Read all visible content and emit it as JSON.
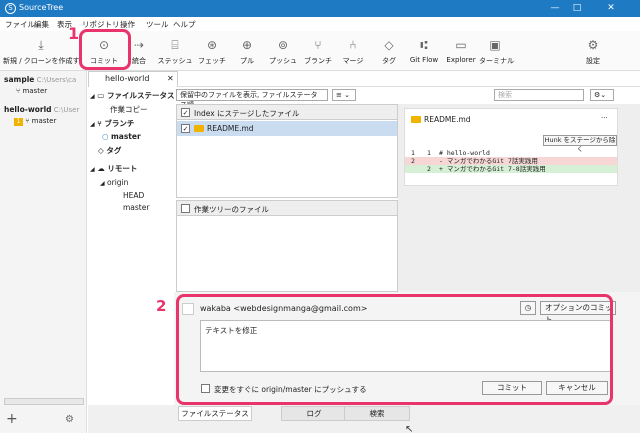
{
  "app": {
    "title": "SourceTree",
    "logo": "S"
  },
  "window_controls": [
    "—",
    "□",
    "✕"
  ],
  "menu": [
    "ファイル",
    "編集",
    "表示",
    "リポジトリ",
    "操作",
    "ツール",
    "ヘルプ"
  ],
  "toolbar": {
    "new_clone": "新規 / クローンを作成す",
    "buttons": [
      {
        "label": "コミット",
        "icon": "commit-icon",
        "glyph": "⊙"
      },
      {
        "label": "統合",
        "icon": "merge-icon",
        "glyph": "⇢"
      },
      {
        "label": "ステッシュ",
        "icon": "stash-icon",
        "glyph": "⌸"
      },
      {
        "label": "フェッチ",
        "icon": "fetch-icon",
        "glyph": "⊛"
      },
      {
        "label": "プル",
        "icon": "pull-icon",
        "glyph": "⊕"
      },
      {
        "label": "プッシュ",
        "icon": "push-icon",
        "glyph": "⊚"
      },
      {
        "label": "ブランチ",
        "icon": "branch-icon",
        "glyph": "⑂"
      },
      {
        "label": "マージ",
        "icon": "merge-branch-icon",
        "glyph": "⑃"
      },
      {
        "label": "タグ",
        "icon": "tag-icon",
        "glyph": "◇"
      },
      {
        "label": "Git Flow",
        "icon": "gitflow-icon",
        "glyph": "⑆"
      },
      {
        "label": "Explorer",
        "icon": "folder-icon",
        "glyph": "▭"
      },
      {
        "label": "ターミナル",
        "icon": "terminal-icon",
        "glyph": "▣"
      }
    ],
    "settings": "設定"
  },
  "sidebar": {
    "repos": [
      {
        "name": "sample",
        "path": "C:\\Users\\ca",
        "branch": "master"
      },
      {
        "name": "hello-world",
        "path": "C:\\User",
        "badge": "1",
        "branch": "master"
      }
    ],
    "add": "+"
  },
  "tab": {
    "label": "hello-world",
    "close": "✕"
  },
  "nav": {
    "file_status": "ファイルステータス",
    "working_copy": "作業コピー",
    "branches": "ブランチ",
    "branch_master": "master",
    "tags": "タグ",
    "remotes": "リモート",
    "origin": "origin",
    "head": "HEAD",
    "remote_master": "master"
  },
  "filter": {
    "select_value": "保留中のファイルを表示, ファイルステータス順",
    "view_menu": "≡",
    "search_placeholder": "検索"
  },
  "staged": {
    "header": "Index にステージしたファイル",
    "files": [
      "README.md"
    ]
  },
  "unstaged": {
    "header": "作業ツリーのファイル"
  },
  "diff": {
    "filename": "README.md",
    "more": "···",
    "hunk_button": "Hunk をステージから除く",
    "lines": [
      {
        "old": "1",
        "new": "1",
        "text": "  # hello-world",
        "kind": "ctx"
      },
      {
        "old": "2",
        "new": "",
        "text": "- マンガでわかるGit 7話実践用",
        "kind": "del"
      },
      {
        "old": "",
        "new": "2",
        "text": "+ マンガでわかるGit 7-8話実践用",
        "kind": "add"
      }
    ]
  },
  "commit": {
    "author": "wakaba <webdesignmanga@gmail.com>",
    "options": "オプションのコミット",
    "message": "テキストを修正",
    "push_label": "変更をすぐに origin/master にプッシュする",
    "commit_btn": "コミット",
    "cancel_btn": "キャンセル"
  },
  "bottom_tabs": [
    "ファイルステータス",
    "ログ",
    "検索"
  ],
  "annotations": {
    "one": "1",
    "two": "2"
  },
  "colors": {
    "titlebar": "#1f7ac4",
    "highlight": "#e8336b",
    "branch_badge": "#f0b400",
    "selection": "#c9dcf0"
  }
}
